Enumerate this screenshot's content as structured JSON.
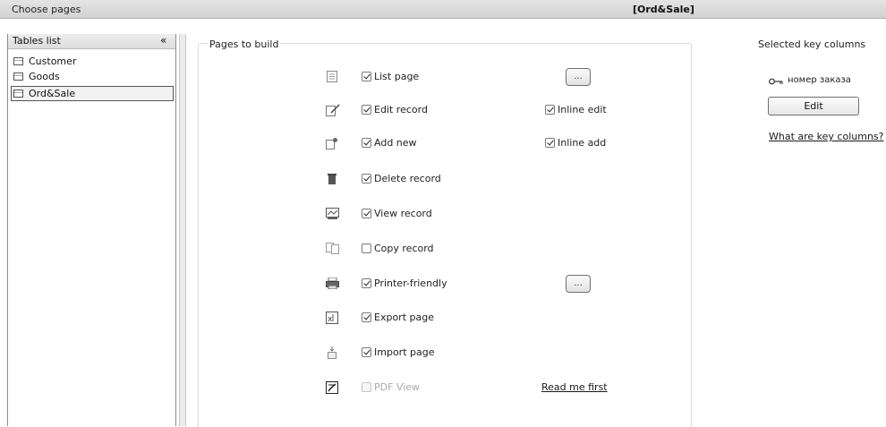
{
  "header": {
    "title": "Choose pages",
    "table_name": "[Ord&Sale]"
  },
  "tables": {
    "title": "Tables list",
    "collapse_symbol": "«",
    "items": [
      {
        "label": "Customer",
        "selected": false
      },
      {
        "label": "Goods",
        "selected": false
      },
      {
        "label": "Ord&Sale",
        "selected": true
      }
    ]
  },
  "pages": {
    "title": "Pages to build",
    "rows": [
      {
        "label": "List page",
        "checked": true,
        "enabled": true,
        "icon": "list-page-icon"
      },
      {
        "label": "Edit record",
        "checked": true,
        "enabled": true,
        "icon": "edit-record-icon"
      },
      {
        "label": "Add new",
        "checked": true,
        "enabled": true,
        "icon": "add-new-icon"
      },
      {
        "label": "Delete record",
        "checked": true,
        "enabled": true,
        "icon": "trash-icon"
      },
      {
        "label": "View record",
        "checked": true,
        "enabled": true,
        "icon": "view-record-icon"
      },
      {
        "label": "Copy record",
        "checked": false,
        "enabled": true,
        "icon": "copy-record-icon"
      },
      {
        "label": "Printer-friendly",
        "checked": true,
        "enabled": true,
        "icon": "printer-icon"
      },
      {
        "label": "Export page",
        "checked": true,
        "enabled": true,
        "icon": "export-icon"
      },
      {
        "label": "Import page",
        "checked": true,
        "enabled": true,
        "icon": "import-icon"
      },
      {
        "label": "PDF View",
        "checked": false,
        "enabled": false,
        "icon": "pdf-icon"
      }
    ],
    "inline_edit": {
      "label": "Inline edit",
      "checked": true
    },
    "inline_add": {
      "label": "Inline add",
      "checked": true
    },
    "list_settings_button": "...",
    "printer_settings_button": "...",
    "read_me_link": "Read me first"
  },
  "key_columns": {
    "title": "Selected key columns",
    "column": "номер заказа",
    "key_icon": "key-icon",
    "edit_button": "Edit",
    "help_link": "What are key columns?"
  }
}
